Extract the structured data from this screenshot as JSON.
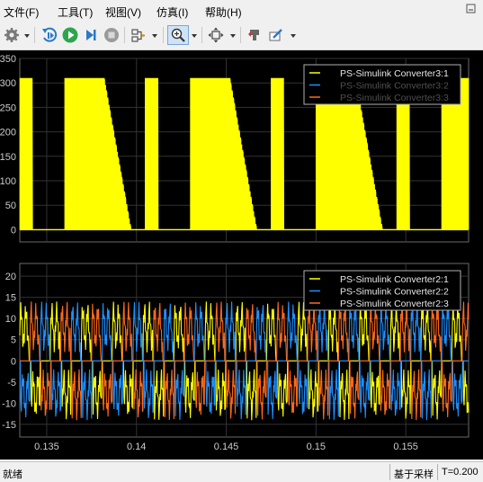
{
  "menu": {
    "items": [
      "文件(F)",
      "工具(T)",
      "视图(V)",
      "仿真(I)",
      "帮助(H)"
    ]
  },
  "toolbar": {
    "icons": [
      "gear-icon",
      "step-back-icon",
      "run-icon",
      "step-forward-icon",
      "stop-icon",
      "signal-select-icon",
      "zoom-icon",
      "fit-to-view-icon",
      "highlight-icon",
      "style-icon"
    ]
  },
  "colors": {
    "series1": "#ffff00",
    "series2": "#1e90ff",
    "series3": "#ff6a1a",
    "grid": "#333333",
    "axis_text": "#cccccc"
  },
  "chart_data": [
    {
      "type": "line",
      "title": "",
      "xlabel": "",
      "ylabel": "",
      "xlim": [
        0.1335,
        0.1585
      ],
      "ylim": [
        -25,
        350
      ],
      "yticks": [
        0,
        50,
        100,
        150,
        200,
        250,
        300,
        350
      ],
      "grid": true,
      "legend_position": "top-right",
      "series": [
        {
          "name": "PS-Simulink Converter3:1",
          "color": "#ffff00",
          "description_values": {
            "x": [
              0.1335,
              0.1375,
              0.1385,
              0.14,
              0.1445,
              0.1455,
              0.147,
              0.1515,
              0.1525,
              0.154,
              0.1585
            ],
            "y": [
              310,
              0,
              310,
              0,
              310,
              0,
              310,
              0,
              310,
              0,
              310
            ]
          }
        },
        {
          "name": "PS-Simulink Converter3:2",
          "color": "#1e90ff",
          "values": []
        },
        {
          "name": "PS-Simulink Converter3:3",
          "color": "#ff6a1a",
          "values": []
        }
      ]
    },
    {
      "type": "line",
      "title": "",
      "xlabel": "",
      "ylabel": "",
      "xlim": [
        0.1335,
        0.1585
      ],
      "ylim": [
        -18,
        23
      ],
      "yticks": [
        -15,
        -10,
        -5,
        0,
        5,
        10,
        15,
        20
      ],
      "xticks": [
        0.135,
        0.14,
        0.145,
        0.15,
        0.155
      ],
      "xtick_labels": [
        "0.135",
        "0.14",
        "0.145",
        "0.15",
        "0.155"
      ],
      "grid": true,
      "legend_position": "top-right",
      "series": [
        {
          "name": "PS-Simulink Converter2:1",
          "color": "#ffff00"
        },
        {
          "name": "PS-Simulink Converter2:2",
          "color": "#1e90ff"
        },
        {
          "name": "PS-Simulink Converter2:3",
          "color": "#ff6a1a"
        }
      ],
      "waveform": {
        "amplitude": 10,
        "period_s": 0.00172,
        "phase_offsets_s": [
          0,
          0.00057,
          0.00115
        ]
      }
    }
  ],
  "status": {
    "left": "就绪",
    "sampling": "基于采样",
    "time": "T=0.200"
  }
}
